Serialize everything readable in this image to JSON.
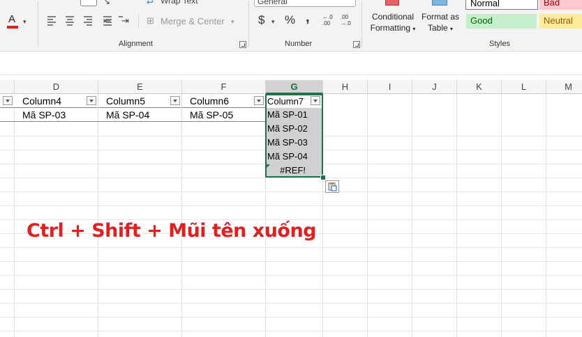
{
  "ribbon": {
    "alignment": {
      "group_label": "Alignment",
      "wrap_text": "Wrap Text",
      "merge_center": "Merge & Center"
    },
    "number": {
      "group_label": "Number",
      "format_value": "General",
      "currency_symbol": "$",
      "percent_symbol": "%",
      "comma_symbol": ",",
      "inc_decimal": "←.0\n.00",
      "dec_decimal": ".00\n→.0"
    },
    "styles": {
      "group_label": "Styles",
      "conditional_formatting": "Conditional",
      "conditional_formatting_2": "Formatting",
      "format_as_table": "Format as",
      "format_as_table_2": "Table",
      "normal": "Normal",
      "bad": "Bad",
      "good": "Good",
      "neutral": "Neutral"
    },
    "colors": {
      "good_bg": "#c6efce",
      "good_fg": "#006100",
      "bad_bg": "#ffc7ce",
      "bad_fg": "#9c0006",
      "neutral_bg": "#ffeb9c",
      "neutral_fg": "#9c5700",
      "font_color_bar": "#e02020"
    }
  },
  "columns": [
    "D",
    "E",
    "F",
    "G",
    "H",
    "I",
    "J",
    "K",
    "L",
    "M"
  ],
  "table": {
    "headers": [
      "Column4",
      "Column5",
      "Column6",
      "Column7"
    ],
    "row1": [
      "Mã SP-03",
      "Mã SP-04",
      "Mã SP-05"
    ]
  },
  "column_g_values": [
    "Mã SP-01",
    "Mã SP-02",
    "Mã SP-03",
    "Mã SP-04",
    "#REF!"
  ],
  "caption": "Ctrl + Shift + Mũi tên xuống",
  "accent": "#217346"
}
